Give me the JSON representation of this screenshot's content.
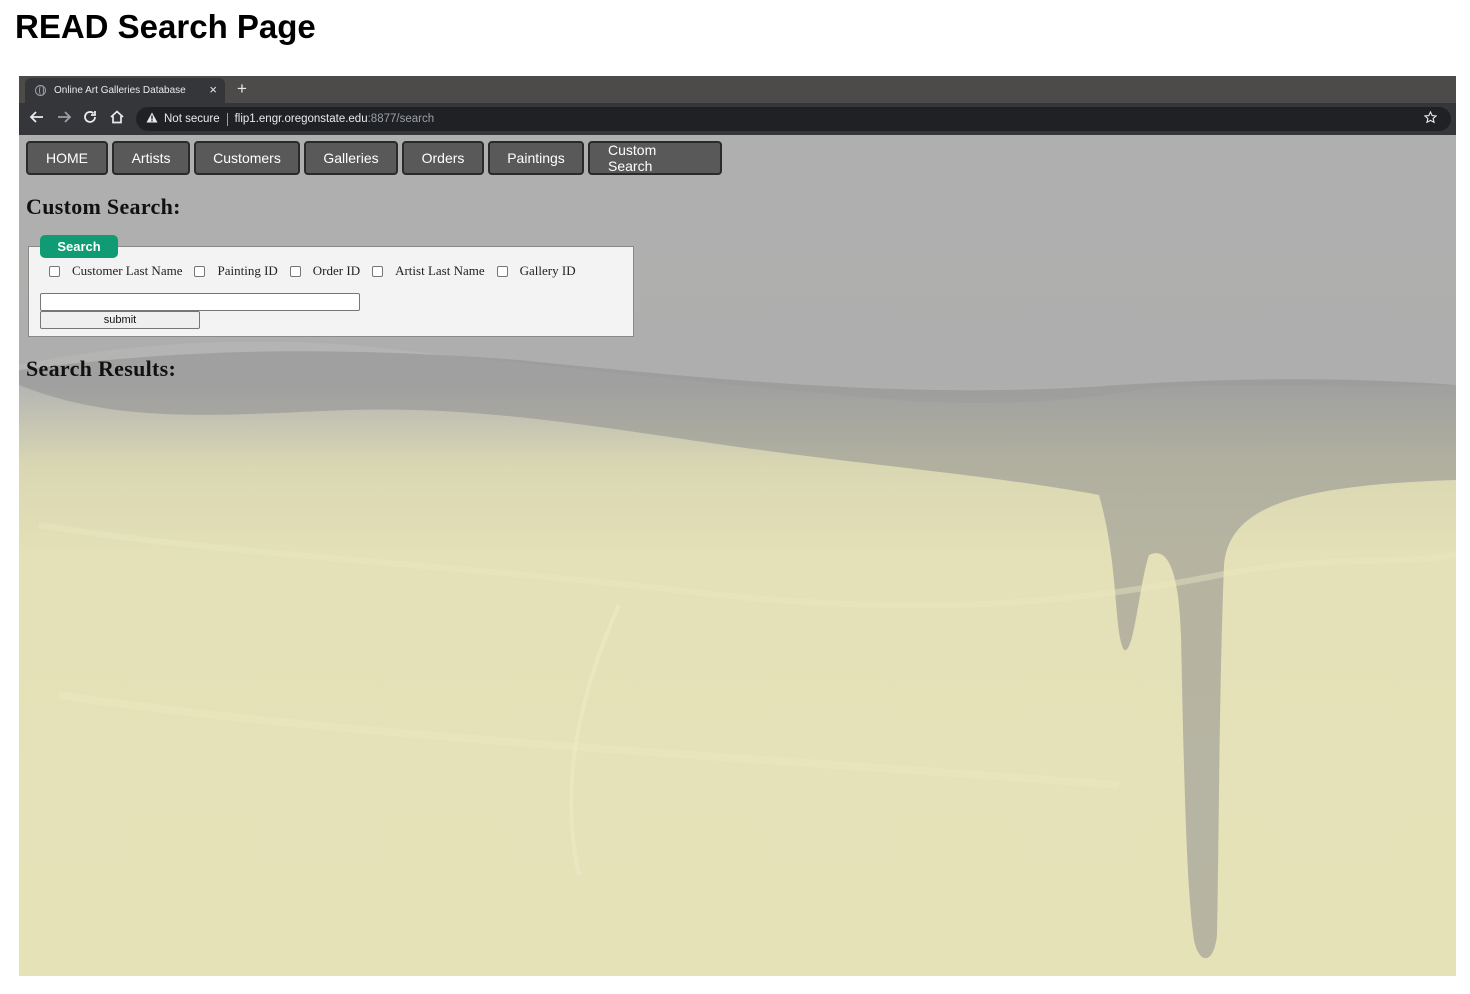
{
  "document": {
    "title": "READ Search Page"
  },
  "browser": {
    "tab_title": "Online Art Galleries Database",
    "tab_close": "×",
    "new_tab": "+",
    "security_label": "Not secure",
    "url_host": "flip1.engr.oregonstate.edu",
    "url_rest": ":8877/search",
    "icons": [
      "back-icon",
      "forward-icon",
      "reload-icon",
      "home-icon",
      "warning-icon",
      "star-icon",
      "globe-icon"
    ]
  },
  "nav": {
    "items": [
      "HOME",
      "Artists",
      "Customers",
      "Galleries",
      "Orders",
      "Paintings",
      "Custom Search"
    ]
  },
  "page": {
    "custom_search_heading": "Custom Search:",
    "search_results_heading": "Search Results:"
  },
  "form": {
    "legend_label": "Search",
    "checkboxes": [
      {
        "label": "Customer Last Name",
        "checked": false
      },
      {
        "label": "Painting ID",
        "checked": false
      },
      {
        "label": "Order ID",
        "checked": false
      },
      {
        "label": "Artist Last Name",
        "checked": false
      },
      {
        "label": "Gallery ID",
        "checked": false
      }
    ],
    "input_value": "",
    "submit_label": "submit"
  },
  "colors": {
    "legend_green": "#0f9b74",
    "nav_button": "#595959",
    "browser_dark": "#35363a"
  }
}
